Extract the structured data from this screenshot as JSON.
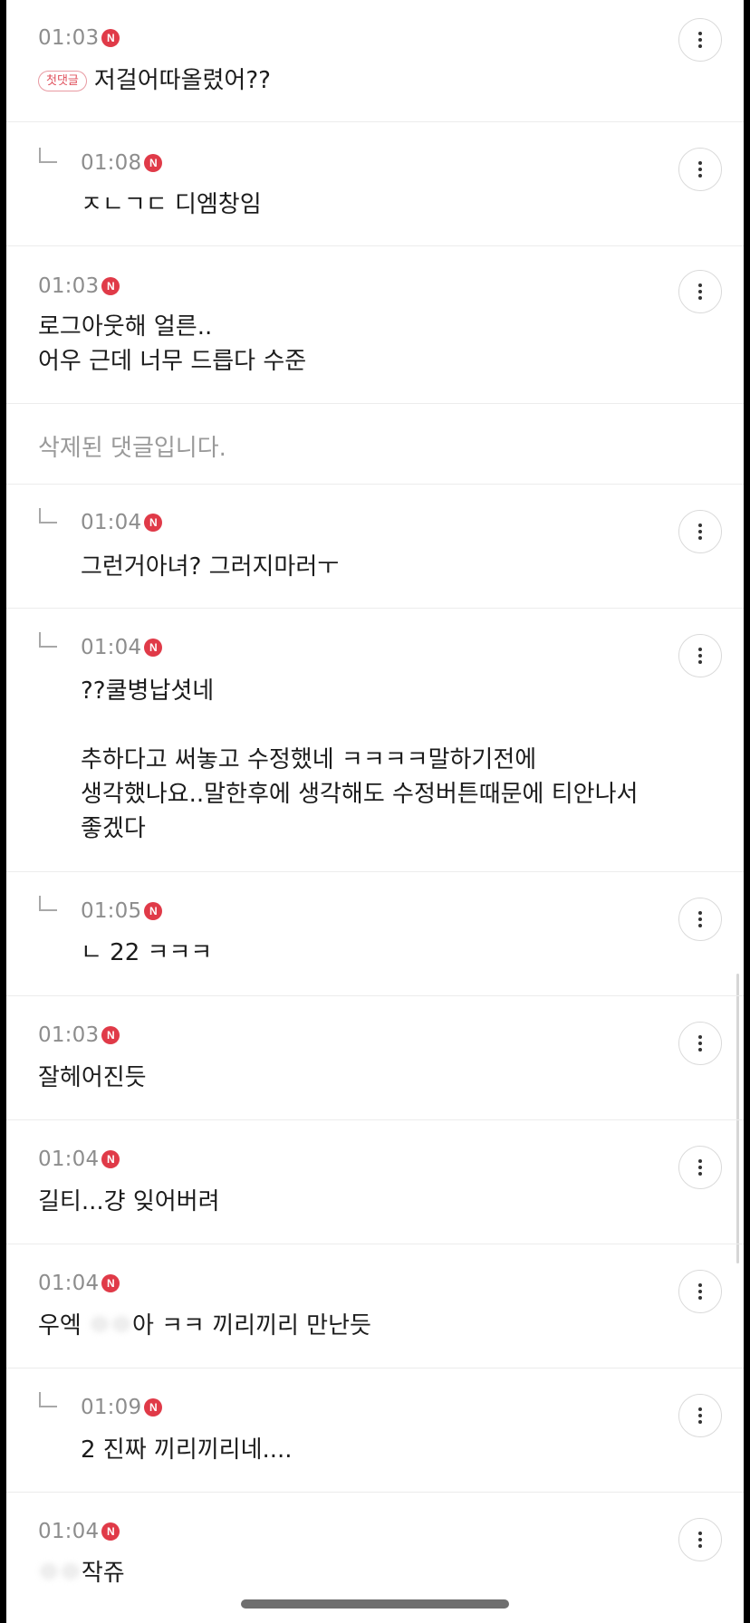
{
  "comments": [
    {
      "time": "01:03",
      "badge": "N",
      "tag": "첫댓글",
      "text": "저걸어따올렸어??"
    },
    {
      "time": "01:08",
      "badge": "N",
      "text": "ㅈㄴㄱㄷ 디엠창임"
    },
    {
      "time": "01:03",
      "badge": "N",
      "text": "로그아웃해 얼른..\n어우 근데 너무 드릅다 수준"
    },
    {
      "deleted_text": "삭제된 댓글입니다."
    },
    {
      "time": "01:04",
      "badge": "N",
      "text": "그런거아녀? 그러지마러ㅜ"
    },
    {
      "time": "01:04",
      "badge": "N",
      "text": "??쿨병납셧네\n\n추하다고 써놓고 수정했네 ㅋㅋㅋㅋ말하기전에\n생각했나요..말한후에 생각해도 수정버튼때문에 티안나서\n좋겠다"
    },
    {
      "time": "01:05",
      "badge": "N",
      "text": "ㄴ 22 ㅋㅋㅋ"
    },
    {
      "time": "01:03",
      "badge": "N",
      "text": "잘헤어진듯"
    },
    {
      "time": "01:04",
      "badge": "N",
      "text": "길티...걍 잊어버려"
    },
    {
      "time": "01:04",
      "badge": "N",
      "text_before": "우엑 ",
      "text_blur": "ㅇㅇ",
      "text_after": "아 ㅋㅋ 끼리끼리 만난듯"
    },
    {
      "time": "01:09",
      "badge": "N",
      "text": "2 진짜 끼리끼리네...."
    },
    {
      "time": "01:04",
      "badge": "N",
      "text_blur": "ㅇㅇ",
      "text_after": "작쥬"
    }
  ],
  "icons": {
    "reply": "reply-arrow-icon",
    "more": "more-vertical-icon",
    "new_badge": "new-badge-icon"
  },
  "colors": {
    "badge_red": "#e03a48",
    "time_gray": "#8d8d8d",
    "divider": "#ececec"
  }
}
